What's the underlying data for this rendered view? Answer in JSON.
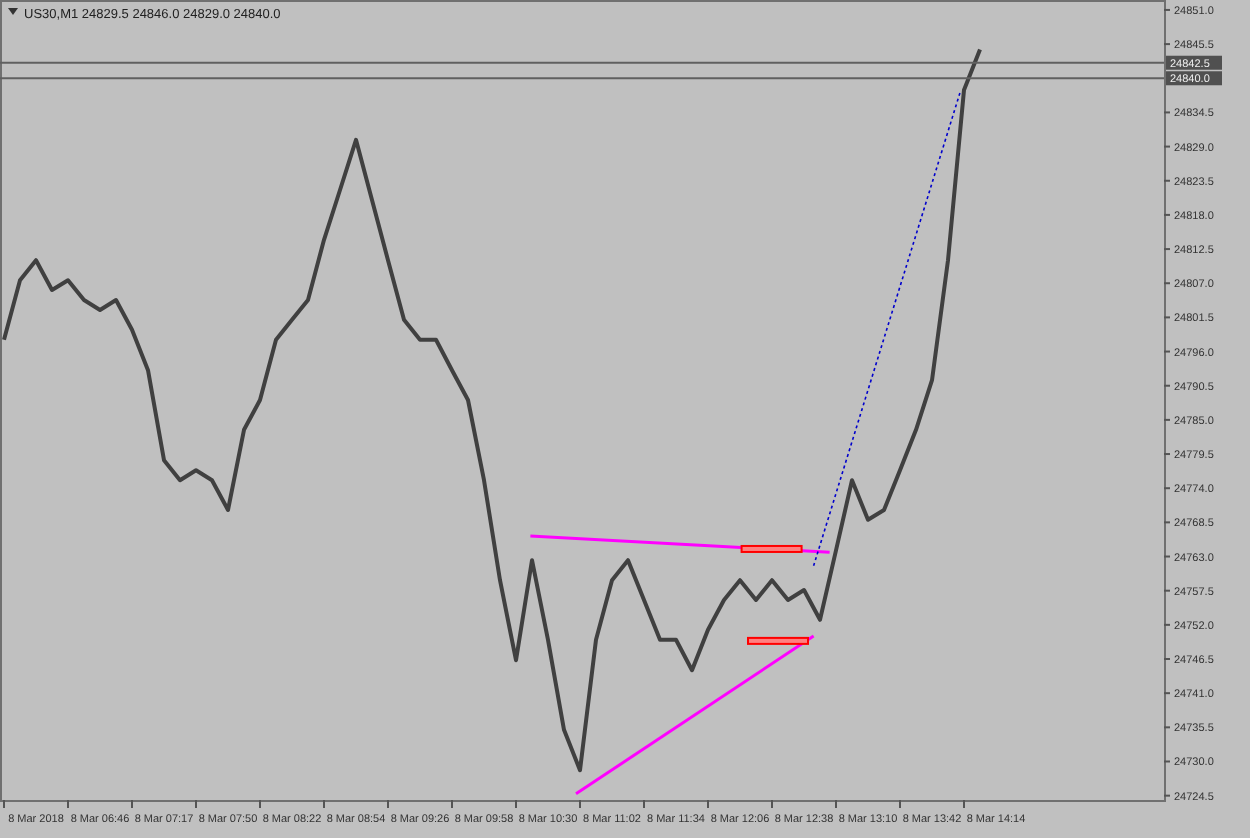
{
  "chart": {
    "title": "US30,M1  24829.5 24846.0 24829.0 24840.0",
    "price_tags": [
      "24842.5",
      "24840.0"
    ],
    "chart_data": {
      "type": "line",
      "categories": [
        null,
        null,
        "8 Mar 2018",
        null,
        null,
        null,
        "8 Mar 06:46",
        null,
        null,
        null,
        "8 Mar 07:17",
        null,
        null,
        null,
        "8 Mar 07:50",
        null,
        null,
        null,
        "8 Mar 08:22",
        null,
        null,
        null,
        "8 Mar 08:54",
        null,
        null,
        null,
        "8 Mar 09:26",
        null,
        null,
        null,
        "8 Mar 09:58",
        null,
        null,
        null,
        "8 Mar 10:30",
        null,
        null,
        null,
        "8 Mar 11:02",
        null,
        null,
        null,
        "8 Mar 11:34",
        null,
        null,
        null,
        "8 Mar 12:06",
        null,
        null,
        null,
        "8 Mar 12:38",
        null,
        null,
        null,
        "8 Mar 13:10",
        null,
        null,
        null,
        "8 Mar 13:42",
        null,
        null,
        null,
        "8 Mar 14:14",
        null,
        null,
        null,
        null,
        null,
        null,
        null,
        null,
        null,
        null
      ],
      "series": [
        {
          "color": "#404040",
          "values": [
            24797.9,
            24807.5,
            24810.7,
            24805.9,
            24807.5,
            24804.3,
            24802.7,
            24804.3,
            24799.5,
            24793.0,
            24778.5,
            24775.3,
            24776.9,
            24775.3,
            24770.5,
            24783.4,
            24788.2,
            24797.9,
            24801.1,
            24804.3,
            24814.0,
            24822.0,
            24830.1,
            24820.4,
            24810.7,
            24801.1,
            24797.9,
            24797.9,
            24793.0,
            24788.2,
            24775.3,
            24759.2,
            24746.3,
            24762.4,
            24749.6,
            24735.1,
            24728.6,
            24749.6,
            24759.2,
            24762.4,
            24756.0,
            24749.6,
            24749.6,
            24744.7,
            24751.2,
            24756.0,
            24759.2,
            24756.0,
            24759.2,
            24756.0,
            24757.6,
            24752.8,
            24764.0,
            24775.3,
            24768.9,
            24770.5,
            24776.9,
            24783.4,
            24791.4,
            24810.7,
            24838.1,
            24844.6,
            null,
            null,
            null,
            null,
            null,
            null,
            null,
            null,
            null,
            null,
            null
          ]
        }
      ],
      "ylim": [
        24723.8,
        24852.6
      ],
      "yticks": [
        {
          "value": 24851.0,
          "label": "24851.0"
        },
        {
          "value": 24845.5,
          "label": "24845.5"
        },
        {
          "value": 24834.5,
          "label": "24834.5"
        },
        {
          "value": 24829.0,
          "label": "24829.0"
        },
        {
          "value": 24823.5,
          "label": "24823.5"
        },
        {
          "value": 24818.0,
          "label": "24818.0"
        },
        {
          "value": 24812.5,
          "label": "24812.5"
        },
        {
          "value": 24807.0,
          "label": "24807.0"
        },
        {
          "value": 24801.5,
          "label": "24801.5"
        },
        {
          "value": 24796.0,
          "label": "24796.0"
        },
        {
          "value": 24790.5,
          "label": "24790.5"
        },
        {
          "value": 24785.0,
          "label": "24785.0"
        },
        {
          "value": 24779.5,
          "label": "24779.5"
        },
        {
          "value": 24774.0,
          "label": "24774.0"
        },
        {
          "value": 24768.5,
          "label": "24768.5"
        },
        {
          "value": 24763.0,
          "label": "24763.0"
        },
        {
          "value": 24757.5,
          "label": "24757.5"
        },
        {
          "value": 24752.0,
          "label": "24752.0"
        },
        {
          "value": 24746.5,
          "label": "24746.5"
        },
        {
          "value": 24741.0,
          "label": "24741.0"
        },
        {
          "value": 24735.5,
          "label": "24735.5"
        },
        {
          "value": 24730.0,
          "label": "24730.0"
        },
        {
          "value": 24724.5,
          "label": "24724.5"
        }
      ]
    }
  }
}
